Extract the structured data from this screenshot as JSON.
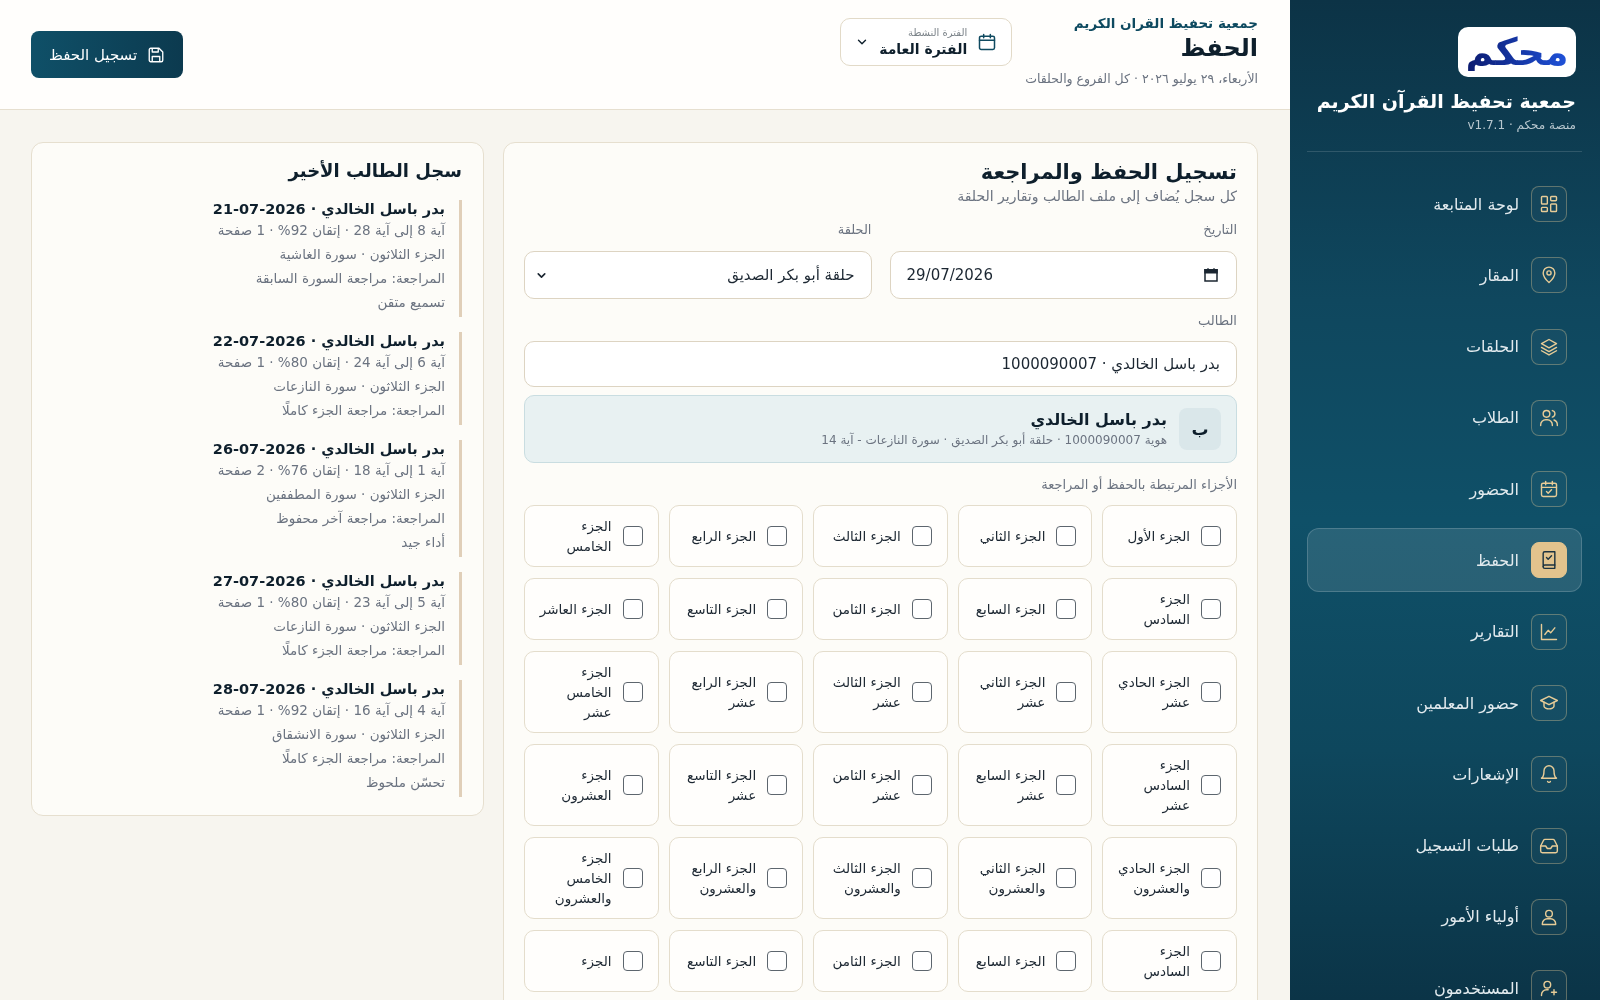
{
  "sidebar": {
    "logo": "محكم",
    "org_name": "جمعية تحفيظ القرآن الكريم",
    "platform": "منصة محكم · v1.7.1",
    "nav": [
      {
        "label": "لوحة المتابعة",
        "selected": false
      },
      {
        "label": "المقار",
        "selected": false
      },
      {
        "label": "الحلقات",
        "selected": false
      },
      {
        "label": "الطلاب",
        "selected": false
      },
      {
        "label": "الحضور",
        "selected": false
      },
      {
        "label": "الحفظ",
        "selected": true
      },
      {
        "label": "التقارير",
        "selected": false
      },
      {
        "label": "حضور المعلمين",
        "selected": false
      },
      {
        "label": "الإشعارات",
        "selected": false
      },
      {
        "label": "طلبات التسجيل",
        "selected": false
      },
      {
        "label": "أولياء الأمور",
        "selected": false
      },
      {
        "label": "المستخدمون",
        "selected": false
      }
    ]
  },
  "header": {
    "org_name": "جمعية تحفيظ القران الكريم",
    "title": "الحفظ",
    "subtitle": "الأربعاء، ٢٩ يوليو ٢٠٢٦ · كل الفروع والحلقات",
    "period": {
      "label": "الفترة النشطة",
      "value": "الفترة العامة"
    },
    "save_button": "تسجيل الحفظ"
  },
  "form": {
    "title": "تسجيل الحفظ والمراجعة",
    "subtitle": "كل سجل يُضاف إلى ملف الطالب وتقارير الحلقة",
    "date": {
      "label": "التاريخ",
      "value": "29/07/2026"
    },
    "circle": {
      "label": "الحلقة",
      "value": "حلقة أبو بكر الصديق"
    },
    "student": {
      "label": "الطالب",
      "value": "بدر باسل الخالدي · 1000090007"
    },
    "student_card": {
      "initial": "ب",
      "name": "بدر باسل الخالدي",
      "details": "هوية 1000090007 · حلقة أبو بكر الصديق · سورة النازعات - آية 14"
    },
    "parts": {
      "label": "الأجزاء المرتبطة بالحفظ أو المراجعة",
      "items": [
        {
          "label": "الجزء الأول",
          "checked": false
        },
        {
          "label": "الجزء الثاني",
          "checked": false
        },
        {
          "label": "الجزء الثالث",
          "checked": false
        },
        {
          "label": "الجزء الرابع",
          "checked": false
        },
        {
          "label": "الجزء الخامس",
          "checked": false
        },
        {
          "label": "الجزء السادس",
          "checked": false
        },
        {
          "label": "الجزء السابع",
          "checked": false
        },
        {
          "label": "الجزء الثامن",
          "checked": false
        },
        {
          "label": "الجزء التاسع",
          "checked": false
        },
        {
          "label": "الجزء العاشر",
          "checked": false
        },
        {
          "label": "الجزء الحادي عشر",
          "checked": false
        },
        {
          "label": "الجزء الثاني عشر",
          "checked": false
        },
        {
          "label": "الجزء الثالث عشر",
          "checked": false
        },
        {
          "label": "الجزء الرابع عشر",
          "checked": false
        },
        {
          "label": "الجزء الخامس عشر",
          "checked": false
        },
        {
          "label": "الجزء السادس عشر",
          "checked": false
        },
        {
          "label": "الجزء السابع عشر",
          "checked": false
        },
        {
          "label": "الجزء الثامن عشر",
          "checked": false
        },
        {
          "label": "الجزء التاسع عشر",
          "checked": false
        },
        {
          "label": "الجزء العشرون",
          "checked": false
        },
        {
          "label": "الجزء الحادي والعشرون",
          "checked": false
        },
        {
          "label": "الجزء الثاني والعشرون",
          "checked": false
        },
        {
          "label": "الجزء الثالث والعشرون",
          "checked": false
        },
        {
          "label": "الجزء الرابع والعشرون",
          "checked": false
        },
        {
          "label": "الجزء الخامس والعشرون",
          "checked": false
        },
        {
          "label": "الجزء السادس",
          "checked": false
        },
        {
          "label": "الجزء السابع",
          "checked": false
        },
        {
          "label": "الجزء الثامن",
          "checked": false
        },
        {
          "label": "الجزء التاسع",
          "checked": false
        },
        {
          "label": "الجزء",
          "checked": false
        }
      ]
    }
  },
  "history": {
    "title": "سجل الطالب الأخير",
    "entries": [
      {
        "title": "بدر باسل الخالدي · 2026-07-21",
        "lines": [
          "آية 8 إلى آية 28 · إتقان 92% · 1 صفحة",
          "الجزء الثلاثون · سورة الغاشية",
          "المراجعة: مراجعة السورة السابقة",
          "تسميع متقن"
        ]
      },
      {
        "title": "بدر باسل الخالدي · 2026-07-22",
        "lines": [
          "آية 6 إلى آية 24 · إتقان 80% · 1 صفحة",
          "الجزء الثلاثون · سورة النازعات",
          "المراجعة: مراجعة الجزء كاملًا"
        ]
      },
      {
        "title": "بدر باسل الخالدي · 2026-07-26",
        "lines": [
          "آية 1 إلى آية 18 · إتقان 76% · 2 صفحة",
          "الجزء الثلاثون · سورة المطففين",
          "المراجعة: مراجعة آخر محفوظ",
          "أداء جيد"
        ]
      },
      {
        "title": "بدر باسل الخالدي · 2026-07-27",
        "lines": [
          "آية 5 إلى آية 23 · إتقان 80% · 1 صفحة",
          "الجزء الثلاثون · سورة النازعات",
          "المراجعة: مراجعة الجزء كاملًا"
        ]
      },
      {
        "title": "بدر باسل الخالدي · 2026-07-28",
        "lines": [
          "آية 4 إلى آية 16 · إتقان 92% · 1 صفحة",
          "الجزء الثلاثون · سورة الانشقاق",
          "المراجعة: مراجعة الجزء كاملًا",
          "تحسّن ملحوظ"
        ]
      }
    ]
  }
}
